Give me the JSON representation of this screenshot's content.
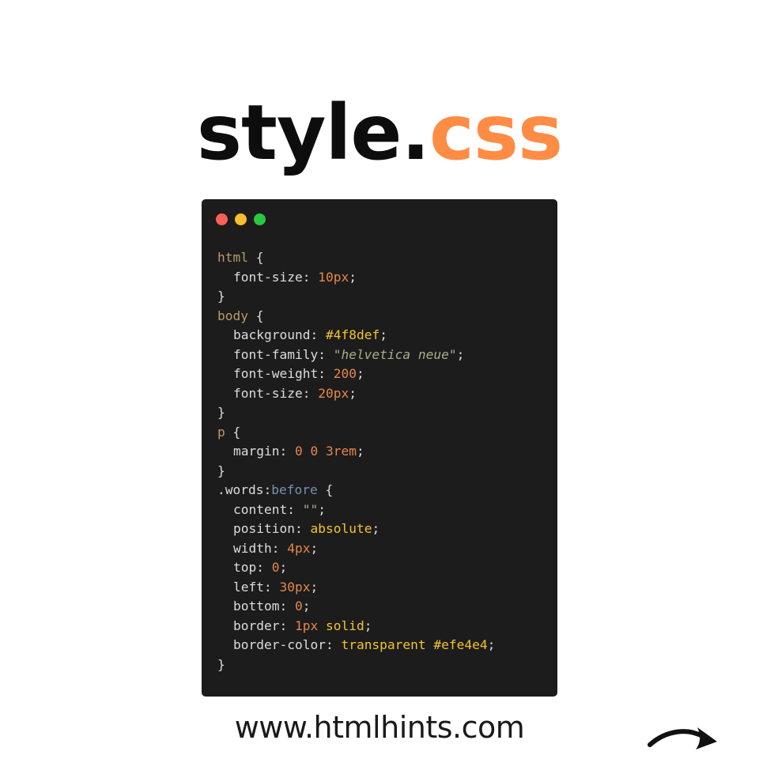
{
  "title": {
    "name": "style.",
    "extension": "css"
  },
  "colors": {
    "accent": "#ff8c45",
    "editor_bg": "#1c1c1c",
    "dot_close": "#fe5f57",
    "dot_minimize": "#febc2e",
    "dot_maximize": "#28c840"
  },
  "window_controls": [
    "close-dot",
    "minimize-dot",
    "maximize-dot"
  ],
  "code_lines": [
    {
      "indent": false,
      "tokens": [
        {
          "t": "sel",
          "v": "html"
        },
        {
          "t": "punct",
          "v": " {"
        }
      ]
    },
    {
      "indent": true,
      "tokens": [
        {
          "t": "prop",
          "v": "font-size"
        },
        {
          "t": "punct",
          "v": ": "
        },
        {
          "t": "num",
          "v": "10px"
        },
        {
          "t": "punct",
          "v": ";"
        }
      ]
    },
    {
      "indent": false,
      "tokens": [
        {
          "t": "punct",
          "v": "}"
        }
      ]
    },
    {
      "indent": false,
      "tokens": [
        {
          "t": "sel",
          "v": "body"
        },
        {
          "t": "punct",
          "v": " {"
        }
      ]
    },
    {
      "indent": true,
      "tokens": [
        {
          "t": "prop",
          "v": "background"
        },
        {
          "t": "punct",
          "v": ": "
        },
        {
          "t": "kw",
          "v": "#4f8def"
        },
        {
          "t": "punct",
          "v": ";"
        }
      ]
    },
    {
      "indent": true,
      "tokens": [
        {
          "t": "prop",
          "v": "font-family"
        },
        {
          "t": "punct",
          "v": ": "
        },
        {
          "t": "str",
          "v": "\"helvetica neue\""
        },
        {
          "t": "punct",
          "v": ";"
        }
      ]
    },
    {
      "indent": true,
      "tokens": [
        {
          "t": "prop",
          "v": "font-weight"
        },
        {
          "t": "punct",
          "v": ": "
        },
        {
          "t": "num",
          "v": "200"
        },
        {
          "t": "punct",
          "v": ";"
        }
      ]
    },
    {
      "indent": true,
      "tokens": [
        {
          "t": "prop",
          "v": "font-size"
        },
        {
          "t": "punct",
          "v": ": "
        },
        {
          "t": "num",
          "v": "20px"
        },
        {
          "t": "punct",
          "v": ";"
        }
      ]
    },
    {
      "indent": false,
      "tokens": [
        {
          "t": "punct",
          "v": "}"
        }
      ]
    },
    {
      "indent": false,
      "tokens": [
        {
          "t": "sel",
          "v": "p"
        },
        {
          "t": "punct",
          "v": " {"
        }
      ]
    },
    {
      "indent": true,
      "tokens": [
        {
          "t": "prop",
          "v": "margin"
        },
        {
          "t": "punct",
          "v": ": "
        },
        {
          "t": "num",
          "v": "0"
        },
        {
          "t": "punct",
          "v": " "
        },
        {
          "t": "num",
          "v": "0"
        },
        {
          "t": "punct",
          "v": " "
        },
        {
          "t": "num",
          "v": "3rem"
        },
        {
          "t": "punct",
          "v": ";"
        }
      ]
    },
    {
      "indent": false,
      "tokens": [
        {
          "t": "punct",
          "v": "}"
        }
      ]
    },
    {
      "indent": false,
      "tokens": [
        {
          "t": "prop",
          "v": ".words:"
        },
        {
          "t": "pseudo",
          "v": "before"
        },
        {
          "t": "punct",
          "v": " {"
        }
      ]
    },
    {
      "indent": true,
      "tokens": [
        {
          "t": "prop",
          "v": "content"
        },
        {
          "t": "punct",
          "v": ": "
        },
        {
          "t": "str",
          "v": "\"\""
        },
        {
          "t": "punct",
          "v": ";"
        }
      ]
    },
    {
      "indent": true,
      "tokens": [
        {
          "t": "prop",
          "v": "position"
        },
        {
          "t": "punct",
          "v": ": "
        },
        {
          "t": "kw",
          "v": "absolute"
        },
        {
          "t": "punct",
          "v": ";"
        }
      ]
    },
    {
      "indent": true,
      "tokens": [
        {
          "t": "prop",
          "v": "width"
        },
        {
          "t": "punct",
          "v": ": "
        },
        {
          "t": "num",
          "v": "4px"
        },
        {
          "t": "punct",
          "v": ";"
        }
      ]
    },
    {
      "indent": true,
      "tokens": [
        {
          "t": "prop",
          "v": "top"
        },
        {
          "t": "punct",
          "v": ": "
        },
        {
          "t": "num",
          "v": "0"
        },
        {
          "t": "punct",
          "v": ";"
        }
      ]
    },
    {
      "indent": true,
      "tokens": [
        {
          "t": "prop",
          "v": "left"
        },
        {
          "t": "punct",
          "v": ": "
        },
        {
          "t": "num",
          "v": "30px"
        },
        {
          "t": "punct",
          "v": ";"
        }
      ]
    },
    {
      "indent": true,
      "tokens": [
        {
          "t": "prop",
          "v": "bottom"
        },
        {
          "t": "punct",
          "v": ": "
        },
        {
          "t": "num",
          "v": "0"
        },
        {
          "t": "punct",
          "v": ";"
        }
      ]
    },
    {
      "indent": true,
      "tokens": [
        {
          "t": "prop",
          "v": "border"
        },
        {
          "t": "punct",
          "v": ": "
        },
        {
          "t": "num",
          "v": "1px"
        },
        {
          "t": "punct",
          "v": " "
        },
        {
          "t": "kw",
          "v": "solid"
        },
        {
          "t": "punct",
          "v": ";"
        }
      ]
    },
    {
      "indent": true,
      "tokens": [
        {
          "t": "prop",
          "v": "border-color"
        },
        {
          "t": "punct",
          "v": ": "
        },
        {
          "t": "kw",
          "v": "transparent"
        },
        {
          "t": "punct",
          "v": " "
        },
        {
          "t": "kw",
          "v": "#efe4e4"
        },
        {
          "t": "punct",
          "v": ";"
        }
      ]
    },
    {
      "indent": false,
      "tokens": [
        {
          "t": "punct",
          "v": "}"
        }
      ]
    }
  ],
  "footer": {
    "website": "www.htmlhints.com",
    "next_icon": "curved-arrow-right-icon"
  }
}
